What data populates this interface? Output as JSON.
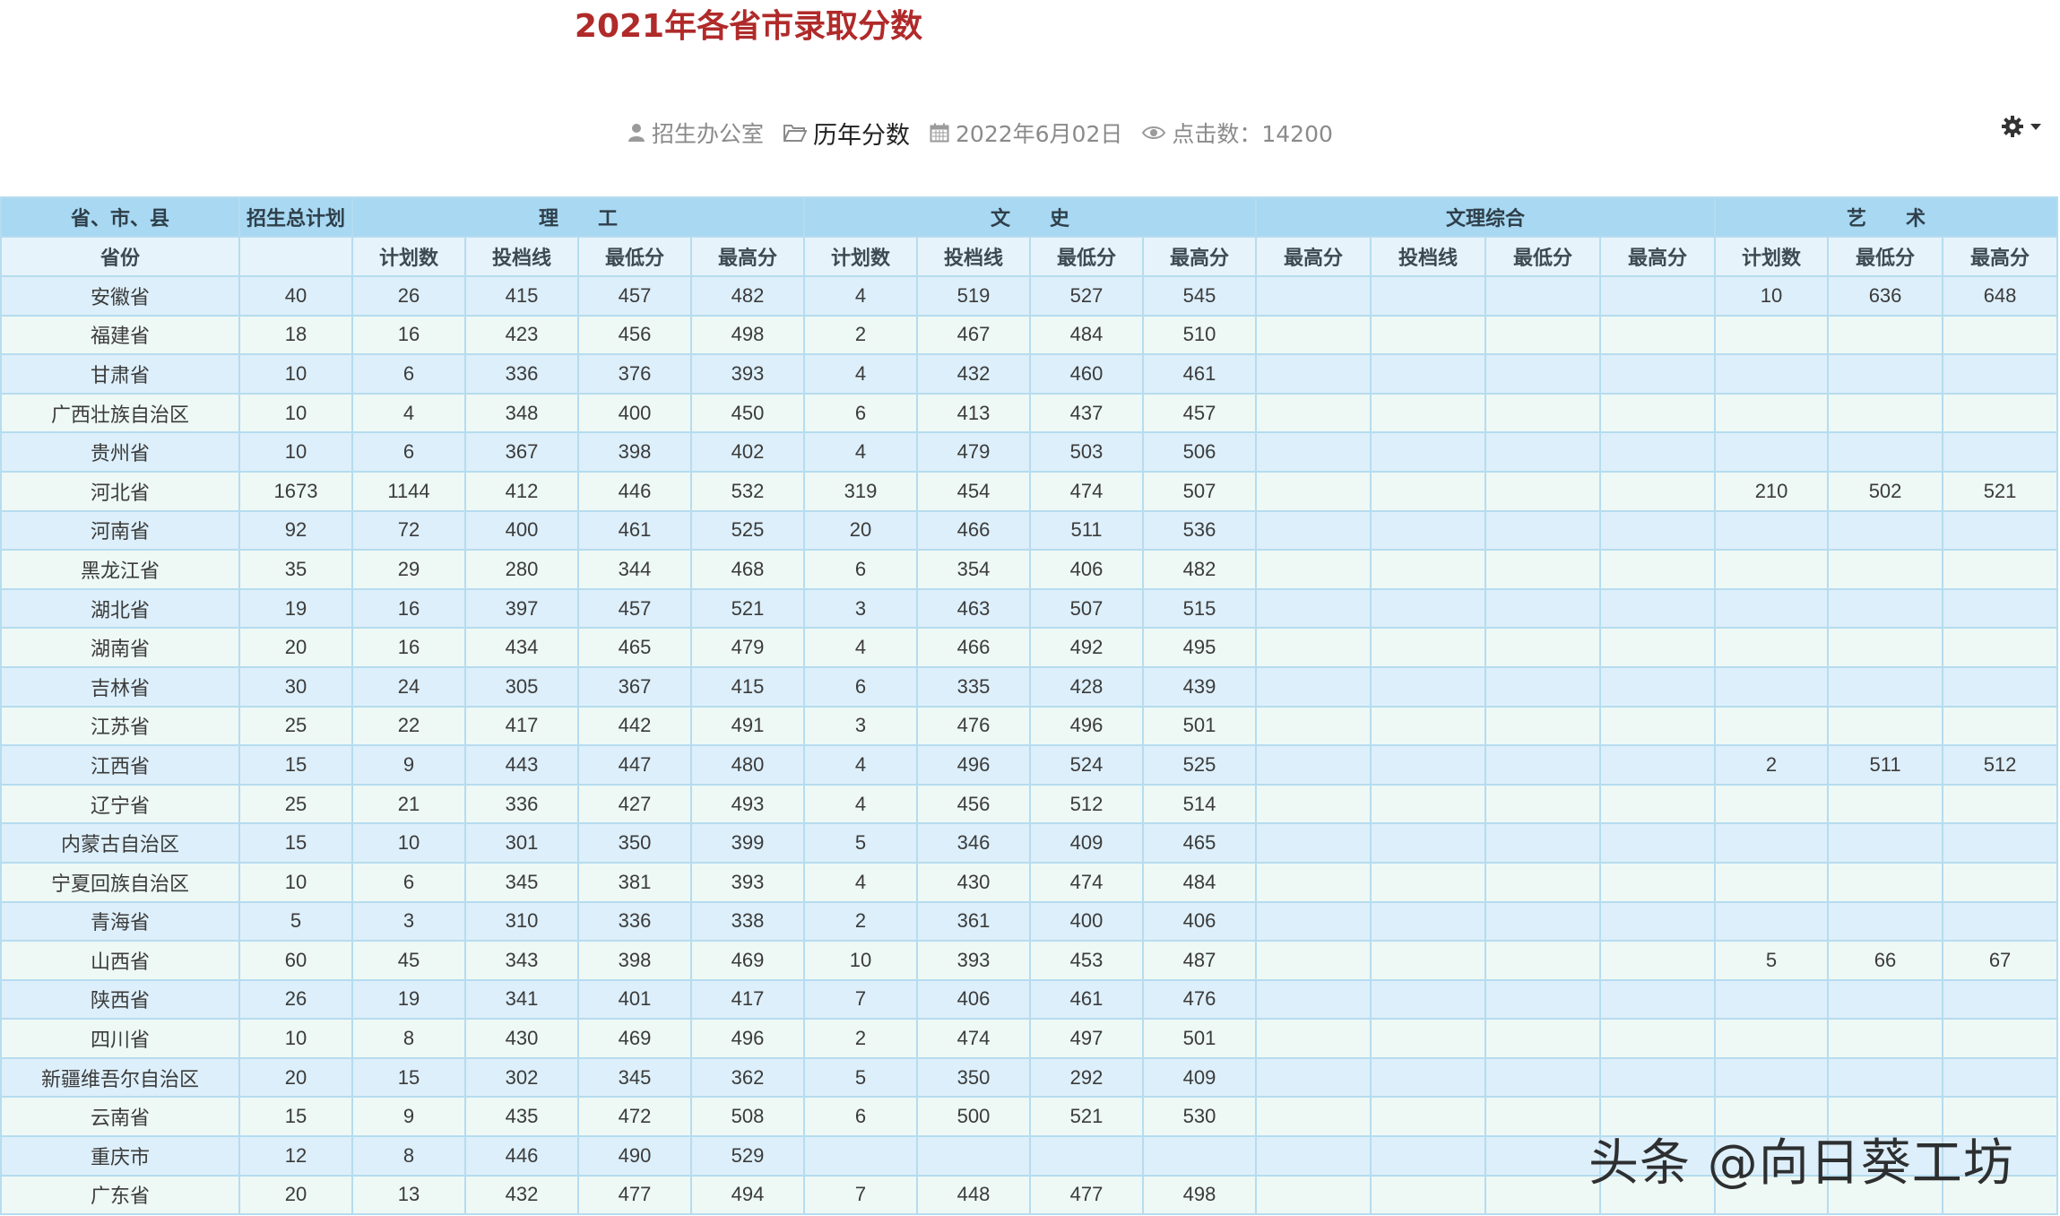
{
  "page": {
    "title": "2021年各省市录取分数",
    "meta": {
      "author": "招生办公室",
      "category": "历年分数",
      "date": "2022年6月02日",
      "views": "点击数：14200"
    },
    "watermark": "头条 @向日葵工坊"
  },
  "icons": {
    "author": "user-icon",
    "category": "folder-icon",
    "date": "calendar-icon",
    "views": "eye-icon",
    "settings": "gear-icon",
    "caret": "caret-down-icon"
  },
  "colors": {
    "title": "#b02a2a",
    "header_bg": "#a8d8f2",
    "subheader_bg": "#e6f3fb",
    "row_odd": "#ddeffa",
    "row_even": "#eef8f5",
    "border": "#b6dcef"
  },
  "table": {
    "group_headers": [
      "省、市、县",
      "招生总计划",
      "理　　工",
      "文　　史",
      "文理综合",
      "艺　　术"
    ],
    "columns": [
      "省份",
      "",
      "计划数",
      "投档线",
      "最低分",
      "最高分",
      "计划数",
      "投档线",
      "最低分",
      "最高分",
      "最高分",
      "投档线",
      "最低分",
      "最高分",
      "计划数",
      "最低分",
      "最高分"
    ],
    "rows": [
      [
        "安徽省",
        "40",
        "26",
        "415",
        "457",
        "482",
        "4",
        "519",
        "527",
        "545",
        "",
        "",
        "",
        "",
        "10",
        "636",
        "648"
      ],
      [
        "福建省",
        "18",
        "16",
        "423",
        "456",
        "498",
        "2",
        "467",
        "484",
        "510",
        "",
        "",
        "",
        "",
        "",
        "",
        ""
      ],
      [
        "甘肃省",
        "10",
        "6",
        "336",
        "376",
        "393",
        "4",
        "432",
        "460",
        "461",
        "",
        "",
        "",
        "",
        "",
        "",
        ""
      ],
      [
        "广西壮族自治区",
        "10",
        "4",
        "348",
        "400",
        "450",
        "6",
        "413",
        "437",
        "457",
        "",
        "",
        "",
        "",
        "",
        "",
        ""
      ],
      [
        "贵州省",
        "10",
        "6",
        "367",
        "398",
        "402",
        "4",
        "479",
        "503",
        "506",
        "",
        "",
        "",
        "",
        "",
        "",
        ""
      ],
      [
        "河北省",
        "1673",
        "1144",
        "412",
        "446",
        "532",
        "319",
        "454",
        "474",
        "507",
        "",
        "",
        "",
        "",
        "210",
        "502",
        "521"
      ],
      [
        "河南省",
        "92",
        "72",
        "400",
        "461",
        "525",
        "20",
        "466",
        "511",
        "536",
        "",
        "",
        "",
        "",
        "",
        "",
        ""
      ],
      [
        "黑龙江省",
        "35",
        "29",
        "280",
        "344",
        "468",
        "6",
        "354",
        "406",
        "482",
        "",
        "",
        "",
        "",
        "",
        "",
        ""
      ],
      [
        "湖北省",
        "19",
        "16",
        "397",
        "457",
        "521",
        "3",
        "463",
        "507",
        "515",
        "",
        "",
        "",
        "",
        "",
        "",
        ""
      ],
      [
        "湖南省",
        "20",
        "16",
        "434",
        "465",
        "479",
        "4",
        "466",
        "492",
        "495",
        "",
        "",
        "",
        "",
        "",
        "",
        ""
      ],
      [
        "吉林省",
        "30",
        "24",
        "305",
        "367",
        "415",
        "6",
        "335",
        "428",
        "439",
        "",
        "",
        "",
        "",
        "",
        "",
        ""
      ],
      [
        "江苏省",
        "25",
        "22",
        "417",
        "442",
        "491",
        "3",
        "476",
        "496",
        "501",
        "",
        "",
        "",
        "",
        "",
        "",
        ""
      ],
      [
        "江西省",
        "15",
        "9",
        "443",
        "447",
        "480",
        "4",
        "496",
        "524",
        "525",
        "",
        "",
        "",
        "",
        "2",
        "511",
        "512"
      ],
      [
        "辽宁省",
        "25",
        "21",
        "336",
        "427",
        "493",
        "4",
        "456",
        "512",
        "514",
        "",
        "",
        "",
        "",
        "",
        "",
        ""
      ],
      [
        "内蒙古自治区",
        "15",
        "10",
        "301",
        "350",
        "399",
        "5",
        "346",
        "409",
        "465",
        "",
        "",
        "",
        "",
        "",
        "",
        ""
      ],
      [
        "宁夏回族自治区",
        "10",
        "6",
        "345",
        "381",
        "393",
        "4",
        "430",
        "474",
        "484",
        "",
        "",
        "",
        "",
        "",
        "",
        ""
      ],
      [
        "青海省",
        "5",
        "3",
        "310",
        "336",
        "338",
        "2",
        "361",
        "400",
        "406",
        "",
        "",
        "",
        "",
        "",
        "",
        ""
      ],
      [
        "山西省",
        "60",
        "45",
        "343",
        "398",
        "469",
        "10",
        "393",
        "453",
        "487",
        "",
        "",
        "",
        "",
        "5",
        "66",
        "67"
      ],
      [
        "陕西省",
        "26",
        "19",
        "341",
        "401",
        "417",
        "7",
        "406",
        "461",
        "476",
        "",
        "",
        "",
        "",
        "",
        "",
        ""
      ],
      [
        "四川省",
        "10",
        "8",
        "430",
        "469",
        "496",
        "2",
        "474",
        "497",
        "501",
        "",
        "",
        "",
        "",
        "",
        "",
        ""
      ],
      [
        "新疆维吾尔自治区",
        "20",
        "15",
        "302",
        "345",
        "362",
        "5",
        "350",
        "292",
        "409",
        "",
        "",
        "",
        "",
        "",
        "",
        ""
      ],
      [
        "云南省",
        "15",
        "9",
        "435",
        "472",
        "508",
        "6",
        "500",
        "521",
        "530",
        "",
        "",
        "",
        "",
        "",
        "",
        ""
      ],
      [
        "重庆市",
        "12",
        "8",
        "446",
        "490",
        "529",
        "",
        "",
        "",
        "",
        "",
        "",
        "",
        "",
        "",
        "",
        ""
      ],
      [
        "广东省",
        "20",
        "13",
        "432",
        "477",
        "494",
        "7",
        "448",
        "477",
        "498",
        "",
        "",
        "",
        "",
        "",
        "",
        ""
      ]
    ]
  }
}
